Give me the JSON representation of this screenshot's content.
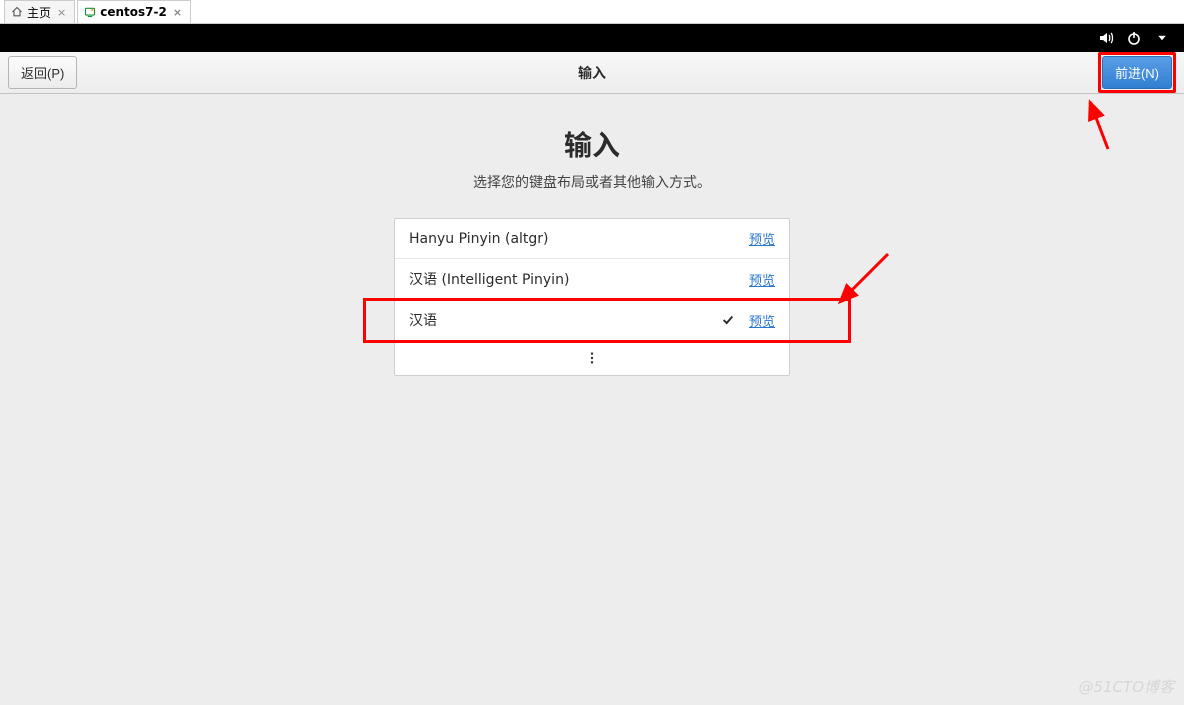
{
  "browser_tabs": {
    "home_label": "主页",
    "vm_label": "centos7-2"
  },
  "topbar_icons": {
    "sound": "sound-icon",
    "power": "power-icon",
    "dropdown": "chevron-down-icon"
  },
  "header": {
    "back_label": "返回(P)",
    "title": "输入",
    "forward_label": "前进(N)"
  },
  "content": {
    "title": "输入",
    "subtitle": "选择您的键盘布局或者其他输入方式。",
    "preview_label": "预览",
    "items": [
      {
        "name": "Hanyu Pinyin (altgr)",
        "selected": false
      },
      {
        "name": "汉语 (Intelligent Pinyin)",
        "selected": false
      },
      {
        "name": "汉语",
        "selected": true
      }
    ],
    "more_label": "⋮"
  },
  "watermark": "@51CTO博客"
}
